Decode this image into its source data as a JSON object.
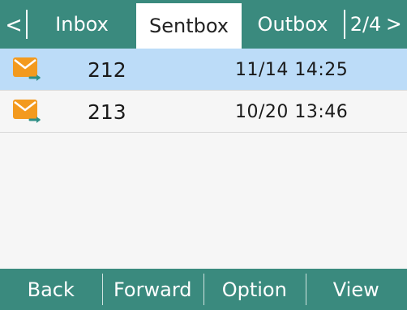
{
  "tabbar": {
    "left_arrow": "<",
    "tabs": [
      {
        "label": "Inbox",
        "active": false
      },
      {
        "label": "Sentbox",
        "active": true
      },
      {
        "label": "Outbox",
        "active": false
      }
    ],
    "page_indicator": "2/4",
    "right_arrow": ">"
  },
  "messages": [
    {
      "number": "212",
      "time": "11/14 14:25",
      "selected": true,
      "icon": "sent-mail-icon"
    },
    {
      "number": "213",
      "time": "10/20 13:46",
      "selected": false,
      "icon": "sent-mail-icon"
    }
  ],
  "softkeys": [
    {
      "label": "Back"
    },
    {
      "label": "Forward"
    },
    {
      "label": "Option"
    },
    {
      "label": "View"
    }
  ],
  "colors": {
    "bar": "#3a8a7e",
    "selected_row": "#bcdcf8",
    "envelope": "#f39a1e",
    "envelope_arrow": "#2e8f86"
  }
}
